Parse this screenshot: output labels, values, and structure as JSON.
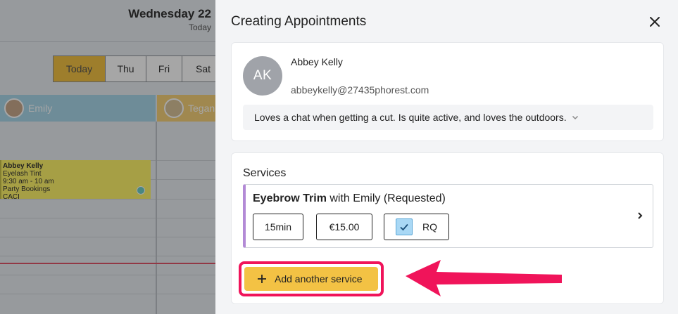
{
  "calendar": {
    "date_title": "Wednesday 22",
    "today_small": "Today",
    "day_tabs": [
      "Today",
      "Thu",
      "Fri",
      "Sat"
    ],
    "staff": [
      "Emily",
      "Tegan"
    ],
    "appointment": {
      "client": "Abbey Kelly",
      "service": "Eyelash Tint",
      "time": "9:30 am - 10 am",
      "category": "Party Bookings",
      "extra": "CACI"
    }
  },
  "panel": {
    "title": "Creating Appointments",
    "close_icon": "close-icon"
  },
  "client": {
    "initials": "AK",
    "name": "Abbey Kelly",
    "email": "abbeykelly@27435phorest.com",
    "notes": "Loves a chat when getting a cut. Is quite active, and loves the outdoors."
  },
  "services": {
    "title": "Services",
    "items": [
      {
        "name": "Eyebrow Trim",
        "with_text": "with Emily (Requested)",
        "duration": "15min",
        "price": "€15.00",
        "rq_label": "RQ",
        "rq_checked": true
      }
    ],
    "add_label": "Add another service"
  },
  "colors": {
    "accent_yellow": "#f3c244",
    "highlight_pink": "#f0145a",
    "service_border": "#b38ad6"
  }
}
